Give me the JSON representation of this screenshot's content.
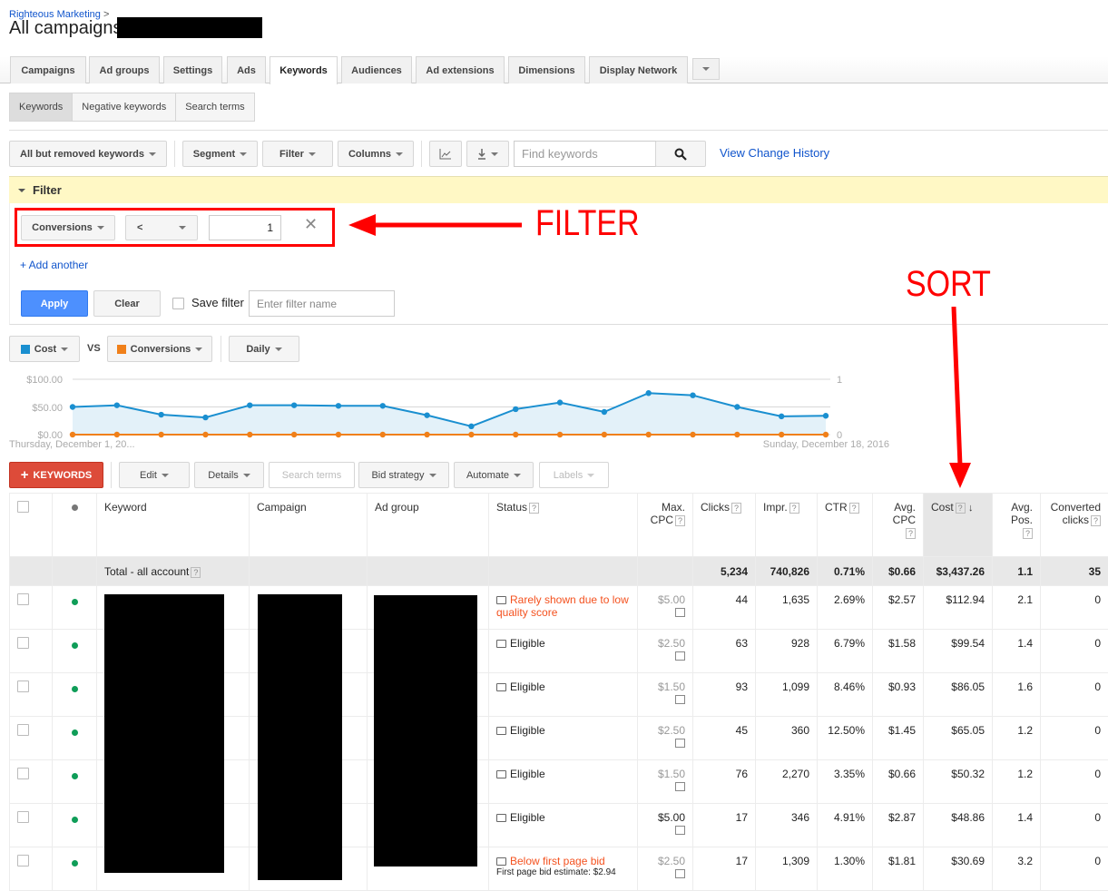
{
  "breadcrumb": {
    "account": "Righteous Marketing",
    "separator": ">"
  },
  "page_title": "All campaigns:",
  "tabs": [
    {
      "label": "Campaigns",
      "active": false
    },
    {
      "label": "Ad groups",
      "active": false
    },
    {
      "label": "Settings",
      "active": false
    },
    {
      "label": "Ads",
      "active": false
    },
    {
      "label": "Keywords",
      "active": true
    },
    {
      "label": "Audiences",
      "active": false
    },
    {
      "label": "Ad extensions",
      "active": false
    },
    {
      "label": "Dimensions",
      "active": false
    },
    {
      "label": "Display Network",
      "active": false
    }
  ],
  "subtabs": [
    {
      "label": "Keywords",
      "active": true
    },
    {
      "label": "Negative keywords",
      "active": false
    },
    {
      "label": "Search terms",
      "active": false
    }
  ],
  "toolbar": {
    "view_filter": "All but removed keywords",
    "segment": "Segment",
    "filter": "Filter",
    "columns": "Columns",
    "search_placeholder": "Find keywords",
    "view_change_history": "View Change History"
  },
  "filter_panel": {
    "title": "Filter",
    "metric": "Conversions",
    "operator": "<",
    "value": "1",
    "add_another": "+ Add another",
    "apply": "Apply",
    "clear": "Clear",
    "save_filter_label": "Save filter",
    "filter_name_placeholder": "Enter filter name"
  },
  "annotations": {
    "filter": "FILTER",
    "sort": "SORT"
  },
  "chart_controls": {
    "metric1": "Cost",
    "vs": "VS",
    "metric2": "Conversions",
    "period": "Daily",
    "metric1_color": "#1a8fd0",
    "metric2_color": "#f0801a"
  },
  "chart_data": {
    "type": "line",
    "series": [
      {
        "name": "Cost",
        "axis": "left",
        "color": "#1a8fd0",
        "values": [
          50,
          53,
          36,
          31,
          53,
          53,
          52,
          52,
          35,
          15,
          46,
          58,
          41,
          75,
          71,
          50,
          33,
          34
        ]
      },
      {
        "name": "Conversions",
        "axis": "right",
        "color": "#f0801a",
        "values": [
          0,
          0,
          0,
          0,
          0,
          0,
          0,
          0,
          0,
          0,
          0,
          0,
          0,
          0,
          0,
          0,
          0,
          0
        ]
      }
    ],
    "x_start_label": "Thursday, December 1, 20...",
    "x_end_label": "Sunday, December 18, 2016",
    "left_axis": {
      "ticks": [
        "$100.00",
        "$50.00",
        "$0.00"
      ],
      "range": [
        0,
        100
      ]
    },
    "right_axis": {
      "ticks": [
        "1",
        "0"
      ],
      "range": [
        0,
        1
      ]
    },
    "grid": true
  },
  "table_toolbar": {
    "add_keywords": "KEYWORDS",
    "edit": "Edit",
    "details": "Details",
    "search_terms": "Search terms",
    "bid_strategy": "Bid strategy",
    "automate": "Automate",
    "labels": "Labels"
  },
  "table": {
    "columns": [
      {
        "label": "Keyword"
      },
      {
        "label": "Campaign"
      },
      {
        "label": "Ad group"
      },
      {
        "label": "Status"
      },
      {
        "label": "Max. CPC"
      },
      {
        "label": "Clicks"
      },
      {
        "label": "Impr."
      },
      {
        "label": "CTR"
      },
      {
        "label": "Avg. CPC"
      },
      {
        "label": "Cost",
        "sorted": "desc"
      },
      {
        "label": "Avg. Pos."
      },
      {
        "label": "Converted clicks"
      }
    ],
    "total": {
      "label": "Total - all account",
      "clicks": "5,234",
      "impr": "740,826",
      "ctr": "0.71%",
      "avg_cpc": "$0.66",
      "cost": "$3,437.26",
      "avg_pos": "1.1",
      "converted_clicks": "35"
    },
    "rows": [
      {
        "status": "Rarely shown due to low quality score",
        "status_type": "warning",
        "status_note": "",
        "max_cpc": "$5.00",
        "max_cpc_muted": true,
        "clicks": "44",
        "impr": "1,635",
        "ctr": "2.69%",
        "avg_cpc": "$2.57",
        "cost": "$112.94",
        "avg_pos": "2.1",
        "converted_clicks": "0"
      },
      {
        "status": "Eligible",
        "status_type": "ok",
        "status_note": "",
        "max_cpc": "$2.50",
        "max_cpc_muted": true,
        "clicks": "63",
        "impr": "928",
        "ctr": "6.79%",
        "avg_cpc": "$1.58",
        "cost": "$99.54",
        "avg_pos": "1.4",
        "converted_clicks": "0"
      },
      {
        "status": "Eligible",
        "status_type": "ok",
        "status_note": "",
        "max_cpc": "$1.50",
        "max_cpc_muted": true,
        "clicks": "93",
        "impr": "1,099",
        "ctr": "8.46%",
        "avg_cpc": "$0.93",
        "cost": "$86.05",
        "avg_pos": "1.6",
        "converted_clicks": "0"
      },
      {
        "status": "Eligible",
        "status_type": "ok",
        "status_note": "",
        "max_cpc": "$2.50",
        "max_cpc_muted": true,
        "clicks": "45",
        "impr": "360",
        "ctr": "12.50%",
        "avg_cpc": "$1.45",
        "cost": "$65.05",
        "avg_pos": "1.2",
        "converted_clicks": "0"
      },
      {
        "status": "Eligible",
        "status_type": "ok",
        "status_note": "",
        "max_cpc": "$1.50",
        "max_cpc_muted": true,
        "clicks": "76",
        "impr": "2,270",
        "ctr": "3.35%",
        "avg_cpc": "$0.66",
        "cost": "$50.32",
        "avg_pos": "1.2",
        "converted_clicks": "0"
      },
      {
        "status": "Eligible",
        "status_type": "ok",
        "status_note": "",
        "max_cpc": "$5.00",
        "max_cpc_muted": false,
        "clicks": "17",
        "impr": "346",
        "ctr": "4.91%",
        "avg_cpc": "$2.87",
        "cost": "$48.86",
        "avg_pos": "1.4",
        "converted_clicks": "0"
      },
      {
        "status": "Below first page bid",
        "status_type": "warning",
        "status_note": "First page bid estimate: $2.94",
        "max_cpc": "$2.50",
        "max_cpc_muted": true,
        "clicks": "17",
        "impr": "1,309",
        "ctr": "1.30%",
        "avg_cpc": "$1.81",
        "cost": "$30.69",
        "avg_pos": "3.2",
        "converted_clicks": "0"
      }
    ]
  }
}
